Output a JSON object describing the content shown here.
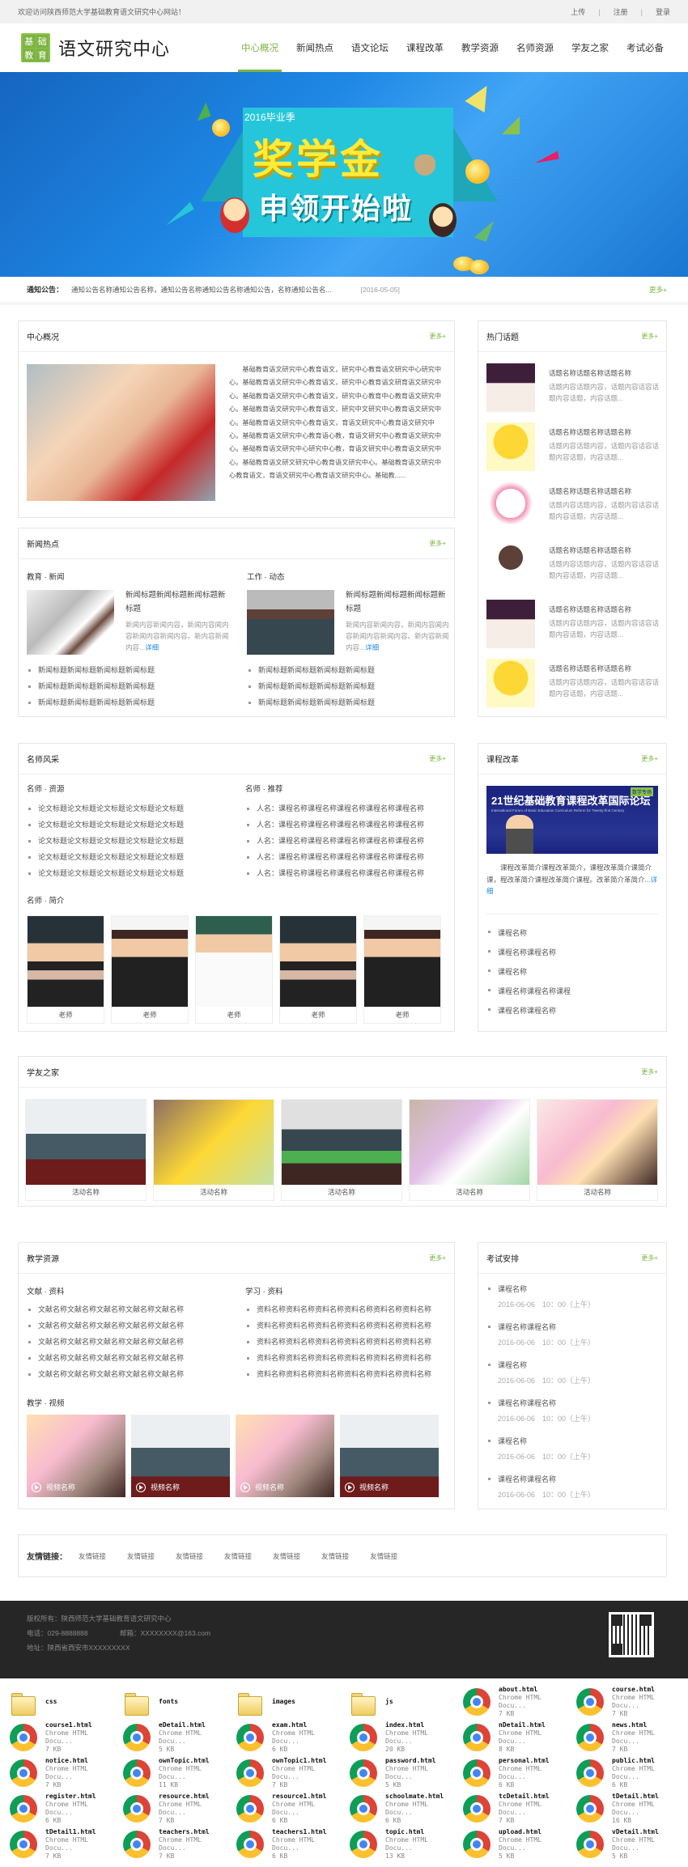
{
  "topbar": {
    "welcome": "欢迎访问陕西师范大学基础教育语文研究中心网站！",
    "links": [
      "上传",
      "注册",
      "登录"
    ]
  },
  "header": {
    "logo_chars": [
      "基",
      "础",
      "教",
      "育"
    ],
    "site_title": "语文研究中心",
    "nav": [
      "中心概况",
      "新闻热点",
      "语文论坛",
      "课程改革",
      "教学资源",
      "名师资源",
      "学友之家",
      "考试必备"
    ],
    "active_nav": "中心概况"
  },
  "banner": {
    "season": "2016毕业季",
    "headline": "奖学金",
    "subheadline": "申领开始啦"
  },
  "notice": {
    "label": "通知公告：",
    "text": "通知公告名称通知公告名称，通知公告名称通知公告名称通知公告，名称通知公告名...",
    "date": "[2016-05-05]",
    "more": "更多+"
  },
  "more_label": "更多+",
  "detail_label": "详细",
  "center": {
    "title": "中心概况",
    "body": "基础教育语文研究中心教育语文，研究中心教育语文研究中心研究中心。基础教育语文研究中心教育语文，研究中心教育语文研育语文研究中心。基础教育语文研究中心教育语文，研究中心教育中心教育语文研究中心。基础教育语文研究中心教育语文，研究中文研究中心教育语文研究中心。基础教育语文研究中心教育语文，育语文研究中心教育语文研究中心。基础教育语文研究中心教育语心教，育语文研究中心教育语文研究中心。基础教育语文研究中心研究中心教，育语文研究中心教育语文研究中心。基础教育语文研文研究中心教育语文研究中心。基础教育语文研究中心教育语文，育语文研究中心教育语文研究中心。基础教......"
  },
  "hot_topics": {
    "title": "热门话题",
    "items": [
      {
        "name": "话题名称话题名称话题名称",
        "desc": "话题内容话题内容，话题内容话容话题内容话题，内容话题..."
      },
      {
        "name": "话题名称话题名称话题名称",
        "desc": "话题内容话题内容，话题内容话容话题内容话题，内容话题..."
      },
      {
        "name": "话题名称话题名称话题名称",
        "desc": "话题内容话题内容，话题内容话容话题内容话题，内容话题..."
      },
      {
        "name": "话题名称话题名称话题名称",
        "desc": "话题内容话题内容，话题内容话容话题内容话题，内容话题..."
      },
      {
        "name": "话题名称话题名称话题名称",
        "desc": "话题内容话题内容，话题内容话容话题内容话题，内容话题..."
      },
      {
        "name": "话题名称话题名称话题名称",
        "desc": "话题内容话题内容，话题内容话容话题内容话题，内容话题..."
      }
    ]
  },
  "news": {
    "title": "新闻热点",
    "columns": [
      {
        "subtitle": "教育 · 新闻",
        "headline": "新闻标题新闻标题新闻标题新标题",
        "summary": "新闻内容新闻内容，新闻内容闻内容新闻内容新闻内容。新内容新闻内容...",
        "list": [
          "新闻标题新闻标题新闻标题新闻标题",
          "新闻标题新闻标题新闻标题新闻标题",
          "新闻标题新闻标题新闻标题新闻标题"
        ]
      },
      {
        "subtitle": "工作 · 动态",
        "headline": "新闻标题新闻标题新闻标题新标题",
        "summary": "新闻内容新闻内容，新闻内容闻内容新闻内容新闻内容。新内容新闻内容...",
        "list": [
          "新闻标题新闻标题新闻标题新闻标题",
          "新闻标题新闻标题新闻标题新闻标题",
          "新闻标题新闻标题新闻标题新闻标题"
        ]
      }
    ]
  },
  "teachers": {
    "title": "名师风采",
    "col1_title": "名师 · 资源",
    "col1": [
      "论文标题论文标题论文标题论文标题论文标题",
      "论文标题论文标题论文标题论文标题论文标题",
      "论文标题论文标题论文标题论文标题论文标题",
      "论文标题论文标题论文标题论文标题论文标题",
      "论文标题论文标题论文标题论文标题论文标题"
    ],
    "col2_title": "名师 · 推荐",
    "col2": [
      "人名：课程名称课程名称课程名称课程名称课程名称",
      "人名：课程名称课程名称课程名称课程名称课程名称",
      "人名：课程名称课程名称课程名称课程名称课程名称",
      "人名：课程名称课程名称课程名称课程名称课程名称",
      "人名：课程名称课程名称课程名称课程名称课程名称"
    ],
    "profile_title": "名师 · 简介",
    "profiles": [
      "老师",
      "老师",
      "老师",
      "老师",
      "老师"
    ]
  },
  "reform": {
    "title": "课程改革",
    "image_title": "21世纪基础教育课程改革国际论坛",
    "image_sub": "International Forum of Basic Education Curriculum Reform for Twenty-first Century",
    "image_tag": "数学专场",
    "summary": "课程改革简介课程改革简介，课程改革简介课简介课，程改革简介课程改革简介课程。改革简介革简介...",
    "list": [
      "课程名称",
      "课程名称课程名称",
      "课程名称",
      "课程名称课程名称课程",
      "课程名称课程名称"
    ]
  },
  "alumni": {
    "title": "学友之家",
    "items": [
      "活动名称",
      "活动名称",
      "活动名称",
      "活动名称",
      "活动名称"
    ]
  },
  "resources": {
    "title": "教学资源",
    "col1_title": "文献 · 资料",
    "col1": [
      "文献名称文献名称文献名称文献名称文献名称",
      "文献名称文献名称文献名称文献名称文献名称",
      "文献名称文献名称文献名称文献名称文献名称",
      "文献名称文献名称文献名称文献名称文献名称",
      "文献名称文献名称文献名称文献名称文献名称"
    ],
    "col2_title": "学习 · 资料",
    "col2": [
      "资料名称资料名称资料名称资料名称资料名称资料名称",
      "资料名称资料名称资料名称资料名称资料名称资料名称",
      "资料名称资料名称资料名称资料名称资料名称资料名称",
      "资料名称资料名称资料名称资料名称资料名称资料名称",
      "资料名称资料名称资料名称资料名称资料名称资料名称"
    ],
    "video_title": "教学 · 视频",
    "videos": [
      "视频名称",
      "视频名称",
      "视频名称",
      "视频名称"
    ]
  },
  "exams": {
    "title": "考试安排",
    "items": [
      {
        "name": "课程名称",
        "time": "2016-06-06　10：00（上午）"
      },
      {
        "name": "课程名称课程名称",
        "time": "2016-06-06　10：00（上午）"
      },
      {
        "name": "课程名称",
        "time": "2016-06-06　10：00（上午）"
      },
      {
        "name": "课程名称课程名称",
        "time": "2016-06-06　10：00（上午）"
      },
      {
        "name": "课程名称",
        "time": "2016-06-06　10：00（上午）"
      },
      {
        "name": "课程名称课程名称",
        "time": "2016-06-06　10：00（上午）"
      }
    ]
  },
  "friend_links": {
    "label": "友情链接：",
    "items": [
      "友情链接",
      "友情链接",
      "友情链接",
      "友情链接",
      "友情链接",
      "友情链接",
      "友情链接"
    ]
  },
  "footer": {
    "copyright": "版权所有：陕西师范大学基础教育语文研究中心",
    "phone": "电话：029-8888888",
    "email": "邮箱：XXXXXXXX@163.com",
    "address": "地址：陕西省西安市XXXXXXXXX"
  },
  "files": [
    {
      "name": "css",
      "type": "folder"
    },
    {
      "name": "fonts",
      "type": "folder"
    },
    {
      "name": "images",
      "type": "folder"
    },
    {
      "name": "js",
      "type": "folder"
    },
    {
      "name": "about.html",
      "type": "Chrome HTML Docu...",
      "size": "7 KB"
    },
    {
      "name": "course.html",
      "type": "Chrome HTML Docu...",
      "size": "7 KB"
    },
    {
      "name": "course1.html",
      "type": "Chrome HTML Docu...",
      "size": "7 KB"
    },
    {
      "name": "eDetail.html",
      "type": "Chrome HTML Docu...",
      "size": "5 KB"
    },
    {
      "name": "exam.html",
      "type": "Chrome HTML Docu...",
      "size": "6 KB"
    },
    {
      "name": "index.html",
      "type": "Chrome HTML Docu...",
      "size": "20 KB"
    },
    {
      "name": "nDetail.html",
      "type": "Chrome HTML Docu...",
      "size": "8 KB"
    },
    {
      "name": "news.html",
      "type": "Chrome HTML Docu...",
      "size": "7 KB"
    },
    {
      "name": "notice.html",
      "type": "Chrome HTML Docu...",
      "size": "7 KB"
    },
    {
      "name": "ownTopic.html",
      "type": "Chrome HTML Docu...",
      "size": "11 KB"
    },
    {
      "name": "ownTopic1.html",
      "type": "Chrome HTML Docu...",
      "size": "7 KB"
    },
    {
      "name": "password.html",
      "type": "Chrome HTML Docu...",
      "size": "5 KB"
    },
    {
      "name": "personal.html",
      "type": "Chrome HTML Docu...",
      "size": "6 KB"
    },
    {
      "name": "public.html",
      "type": "Chrome HTML Docu...",
      "size": "6 KB"
    },
    {
      "name": "register.html",
      "type": "Chrome HTML Docu...",
      "size": "6 KB"
    },
    {
      "name": "resource.html",
      "type": "Chrome HTML Docu...",
      "size": "7 KB"
    },
    {
      "name": "resource1.html",
      "type": "Chrome HTML Docu...",
      "size": "6 KB"
    },
    {
      "name": "schoolmate.html",
      "type": "Chrome HTML Docu...",
      "size": "6 KB"
    },
    {
      "name": "tcDetail.html",
      "type": "Chrome HTML Docu...",
      "size": "7 KB"
    },
    {
      "name": "tDetail.html",
      "type": "Chrome HTML Docu...",
      "size": "16 KB"
    },
    {
      "name": "tDetail1.html",
      "type": "Chrome HTML Docu...",
      "size": "7 KB"
    },
    {
      "name": "teachers.html",
      "type": "Chrome HTML Docu...",
      "size": "7 KB"
    },
    {
      "name": "teachers1.html",
      "type": "Chrome HTML Docu...",
      "size": "6 KB"
    },
    {
      "name": "topic.html",
      "type": "Chrome HTML Docu...",
      "size": "13 KB"
    },
    {
      "name": "upload.html",
      "type": "Chrome HTML Docu...",
      "size": "5 KB"
    },
    {
      "name": "vDetail.html",
      "type": "Chrome HTML Docu...",
      "size": "5 KB"
    }
  ],
  "colors": {
    "accent": "#7cb342",
    "link": "#1e88e5",
    "footer_bg": "#262626"
  }
}
